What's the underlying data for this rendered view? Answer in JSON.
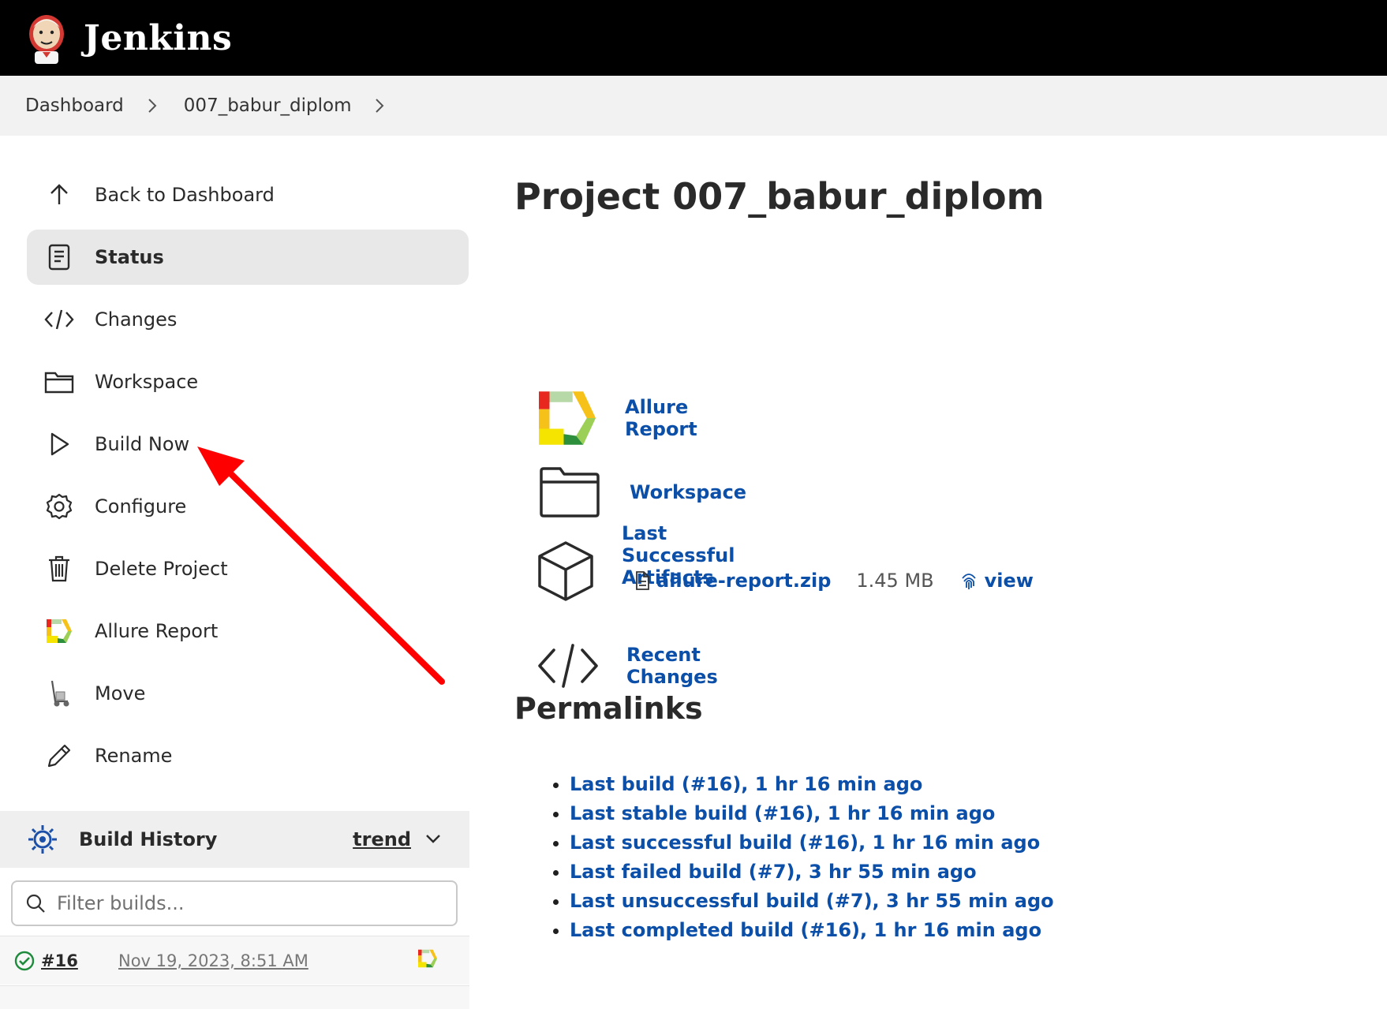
{
  "header": {
    "brand": "Jenkins",
    "logo_icon": "jenkins-butler-icon"
  },
  "breadcrumb": {
    "items": [
      "Dashboard",
      "007_babur_diplom"
    ]
  },
  "sidebar": {
    "items": [
      {
        "label": "Back to Dashboard",
        "icon": "arrow-up-icon",
        "active": false
      },
      {
        "label": "Status",
        "icon": "document-icon",
        "active": true
      },
      {
        "label": "Changes",
        "icon": "code-icon",
        "active": false
      },
      {
        "label": "Workspace",
        "icon": "folder-icon",
        "active": false
      },
      {
        "label": "Build Now",
        "icon": "play-icon",
        "active": false
      },
      {
        "label": "Configure",
        "icon": "gear-icon",
        "active": false
      },
      {
        "label": "Delete Project",
        "icon": "trash-icon",
        "active": false
      },
      {
        "label": "Allure Report",
        "icon": "allure-icon",
        "active": false
      },
      {
        "label": "Move",
        "icon": "hand-truck-icon",
        "active": false
      },
      {
        "label": "Rename",
        "icon": "pencil-icon",
        "active": false
      }
    ]
  },
  "build_history": {
    "title": "Build History",
    "trend_label": "trend",
    "filter_placeholder": "Filter builds...",
    "builds": [
      {
        "number": "#16",
        "date": "Nov 19, 2023, 8:51 AM",
        "status": "success"
      }
    ]
  },
  "main": {
    "title": "Project 007_babur_diplom",
    "links": [
      {
        "label": "Allure Report",
        "icon": "allure-icon"
      },
      {
        "label": "Workspace",
        "icon": "folder-icon"
      },
      {
        "label": "Last Successful Artifacts",
        "icon": "package-icon"
      },
      {
        "label": "Recent Changes",
        "icon": "code-icon"
      }
    ],
    "artifact": {
      "file": "allure-report.zip",
      "size": "1.45 MB",
      "view_label": "view"
    },
    "permalinks_title": "Permalinks",
    "permalinks": [
      "Last build (#16), 1 hr 16 min ago",
      "Last stable build (#16), 1 hr 16 min ago",
      "Last successful build (#16), 1 hr 16 min ago",
      "Last failed build (#7), 3 hr 55 min ago",
      "Last unsuccessful build (#7), 3 hr 55 min ago",
      "Last completed build (#16), 1 hr 16 min ago"
    ]
  },
  "colors": {
    "link": "#0b4fa8",
    "header_bg": "#000000",
    "annotation_arrow": "#ff0000",
    "success": "#1e8a3c"
  }
}
